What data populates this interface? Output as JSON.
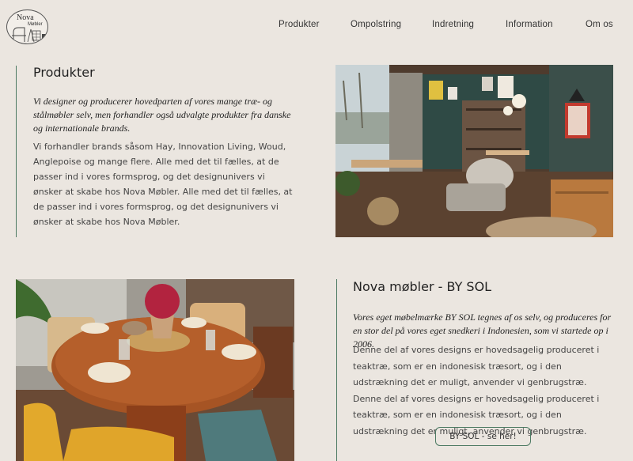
{
  "logo": {
    "line1": "Nova",
    "line2": "Møbler"
  },
  "nav": [
    "Produkter",
    "Ompolstring",
    "Indretning",
    "Information",
    "Om os"
  ],
  "section1": {
    "title": "Produkter",
    "lead": "Vi designer og producerer hovedparten af vores mange træ- og stålmøbler selv, men forhandler også udvalgte produkter fra danske og internationale brands.",
    "body": "Vi forhandler brands såsom Hay, Innovation Living, Woud, Anglepoise og mange flere. Alle med det til fælles, at de passer ind i vores formsprog, og det designunivers vi ønsker at skabe hos Nova Møbler. Alle med det til fælles, at de passer ind i vores formsprog, og det designunivers vi ønsker at skabe hos Nova Møbler."
  },
  "section2": {
    "title": "Nova møbler - BY SOL",
    "lead": "Vores eget møbelmærke BY SOL tegnes af os selv, og produceres for en stor del på vores eget snedkeri i Indonesien, som vi startede op i 2006.",
    "body": "Denne del af vores designs er hovedsagelig produceret i teaktræ, som er en indonesisk træsort, og i den udstrækning det er muligt, anvender vi genbrugstræ. Denne del af vores designs er hovedsagelig produceret i teaktræ, som er en indonesisk træsort, og i den udstrækning det er muligt, anvender vi genbrugstræ.",
    "button": "BY SOL - se her!"
  },
  "colors": {
    "background": "#ebe6e0",
    "accent": "#4d7a63"
  }
}
